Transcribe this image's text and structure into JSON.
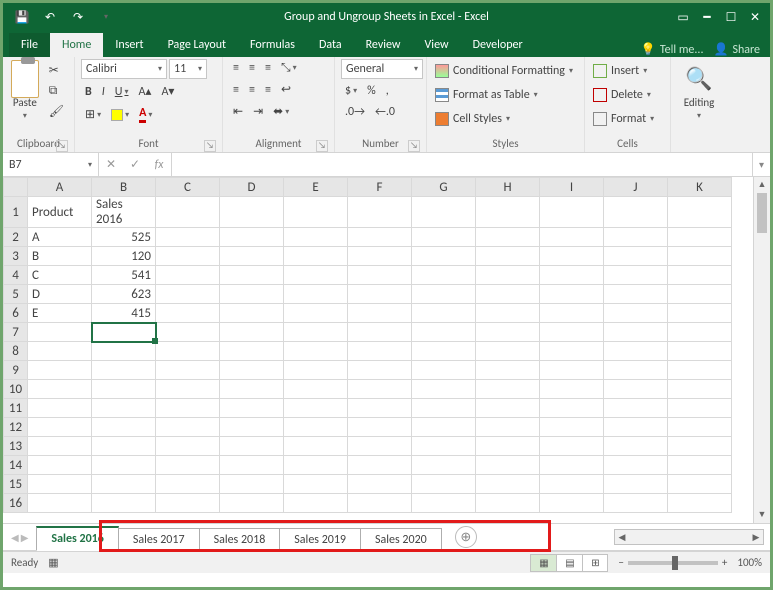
{
  "titlebar": {
    "title": "Group and Ungroup Sheets in Excel - Excel"
  },
  "ribbonTabs": {
    "file": "File",
    "tabs": [
      "Home",
      "Insert",
      "Page Layout",
      "Formulas",
      "Data",
      "Review",
      "View",
      "Developer"
    ],
    "tellMe": "Tell me...",
    "share": "Share"
  },
  "ribbon": {
    "clipboard": {
      "paste": "Paste",
      "label": "Clipboard"
    },
    "font": {
      "name": "Calibri",
      "size": "11",
      "label": "Font"
    },
    "alignment": {
      "label": "Alignment"
    },
    "number": {
      "format": "General",
      "label": "Number"
    },
    "styles": {
      "cond": "Conditional Formatting",
      "table": "Format as Table",
      "cell": "Cell Styles",
      "label": "Styles"
    },
    "cells": {
      "insert": "Insert",
      "delete": "Delete",
      "format": "Format",
      "label": "Cells"
    },
    "editing": {
      "label": "Editing"
    }
  },
  "nameBox": "B7",
  "grid": {
    "columns": [
      "A",
      "B",
      "C",
      "D",
      "E",
      "F",
      "G",
      "H",
      "I",
      "J",
      "K"
    ],
    "rows": [
      1,
      2,
      3,
      4,
      5,
      6,
      7,
      8,
      9,
      10,
      11,
      12,
      13,
      14,
      15,
      16
    ],
    "headers": {
      "A": "Product",
      "B": "Sales 2016"
    },
    "data": [
      {
        "A": "A",
        "B": 525
      },
      {
        "A": "B",
        "B": 120
      },
      {
        "A": "C",
        "B": 541
      },
      {
        "A": "D",
        "B": 623
      },
      {
        "A": "E",
        "B": 415
      }
    ],
    "selectedCell": "B7"
  },
  "sheetTabs": [
    "Sales 2016",
    "Sales 2017",
    "Sales 2018",
    "Sales 2019",
    "Sales 2020"
  ],
  "activeSheet": 0,
  "status": {
    "ready": "Ready",
    "zoom": "100%"
  },
  "chart_data": {
    "type": "table",
    "title": "Sales 2016",
    "columns": [
      "Product",
      "Sales 2016"
    ],
    "rows": [
      [
        "A",
        525
      ],
      [
        "B",
        120
      ],
      [
        "C",
        541
      ],
      [
        "D",
        623
      ],
      [
        "E",
        415
      ]
    ]
  }
}
